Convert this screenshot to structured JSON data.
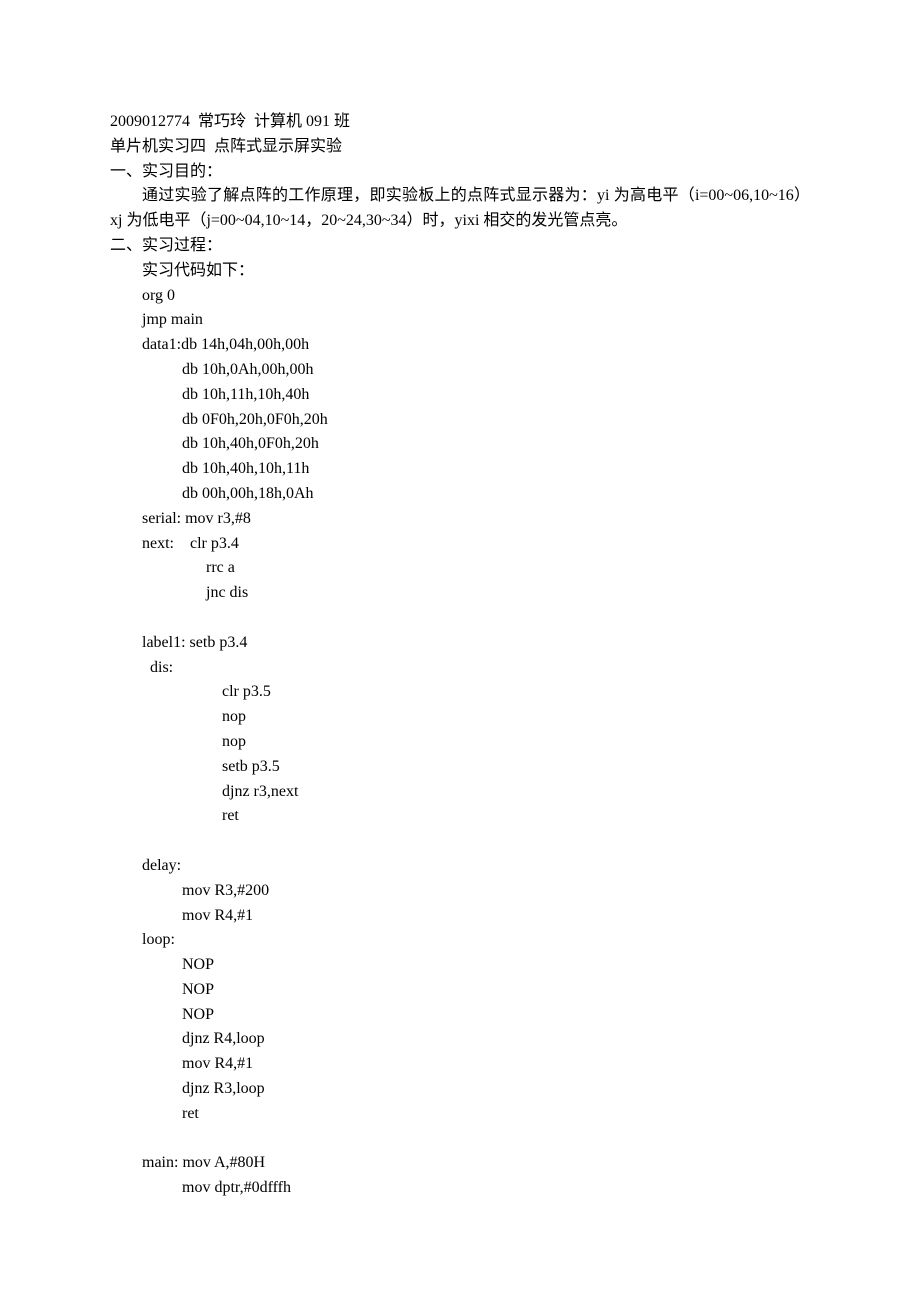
{
  "header": {
    "student_info": "2009012774  常巧玲  计算机 091 班",
    "experiment_title": "单片机实习四  点阵式显示屏实验"
  },
  "sections": {
    "purpose": {
      "heading": "一、实习目的：",
      "body1": "通过实验了解点阵的工作原理，即实验板上的点阵式显示器为：yi 为高电平（i=00~06,10~16）xj 为低电平（j=00~04,10~14，20~24,30~34）时，yixi 相交的发光管点亮。"
    },
    "process": {
      "heading": "二、实习过程：",
      "intro": "实习代码如下：",
      "code": {
        "l1": "org 0",
        "l2": "jmp main",
        "l3": "data1:db 14h,04h,00h,00h",
        "l4": "db 10h,0Ah,00h,00h",
        "l5": "db 10h,11h,10h,40h",
        "l6": "db 0F0h,20h,0F0h,20h",
        "l7": "db 10h,40h,0F0h,20h",
        "l8": "db 10h,40h,10h,11h",
        "l9": "db 00h,00h,18h,0Ah",
        "l10": "serial: mov r3,#8",
        "l11": "next:    clr p3.4",
        "l12": "rrc a",
        "l13": "jnc dis",
        "blank1": "",
        "l14": "label1: setb p3.4",
        "l15": "  dis:",
        "l16": "clr p3.5",
        "l17": "nop",
        "l18": "nop",
        "l19": "setb p3.5",
        "l20": "djnz r3,next",
        "l21": "ret",
        "blank2": "",
        "l22": "delay:",
        "l23": "mov R3,#200",
        "l24": "mov R4,#1",
        "l25": "loop:",
        "l26": "NOP",
        "l27": "NOP",
        "l28": "NOP",
        "l29": "djnz R4,loop",
        "l30": "mov R4,#1",
        "l31": "djnz R3,loop",
        "l32": "ret",
        "blank3": "",
        "l33": "main: mov A,#80H",
        "l34": "mov dptr,#0dfffh"
      }
    }
  }
}
